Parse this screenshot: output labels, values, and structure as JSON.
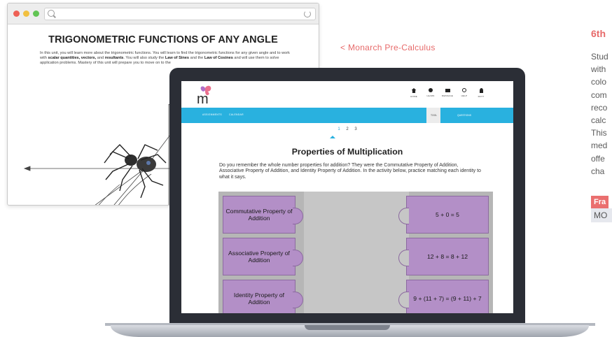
{
  "background_window": {
    "title": "TRIGONOMETRIC FUNCTIONS OF ANY ANGLE",
    "intro": {
      "p1": "In this unit, you will learn more about the trigonometric functions. You will learn to find the trigonometric functions for any given angle and to work with ",
      "b1": "scalar quantities, vectors,",
      "p2": " and ",
      "b2": "resultants",
      "p3": ". You will also study the ",
      "b3": "Law of Sines",
      "p4": " and the ",
      "b4": "Law of Cosines",
      "p5": " and will use them to solve application problems. Mastery of this unit will prepare you to move on to the"
    }
  },
  "back_link": "< Monarch Pre-Calculus",
  "right_column": {
    "heading": "6th",
    "lines": [
      "Stud",
      "with",
      "colo",
      "com",
      "reco",
      "calc",
      "This",
      "med",
      "offe",
      "cha"
    ],
    "badge": "Fra",
    "tag": "MO"
  },
  "app": {
    "nav": [
      {
        "label": "HOME",
        "icon": "home-icon"
      },
      {
        "label": "LEARN",
        "icon": "gear-icon"
      },
      {
        "label": "MESSAGE",
        "icon": "message-icon"
      },
      {
        "label": "HELP",
        "icon": "help-icon"
      },
      {
        "label": "MATT",
        "icon": "user-icon"
      }
    ],
    "bar": {
      "assignments": "ASSIGNMENTS",
      "calendar": "CALENDAR",
      "tab_active": "TOOL",
      "tab_other": "QUESTIONS"
    },
    "pager": [
      "1",
      "2",
      "3"
    ],
    "lesson": {
      "title": "Properties of Multiplication",
      "text": "Do you remember the whole number properties for addition? They were the Commutative Property of Addition, Associative Property of Addition, and Identity Property of Addition. In the activity below, practice matching each identity to what it says."
    },
    "pieces": [
      {
        "left": "Commutative Property of Addition",
        "right": "5 + 0 = 5"
      },
      {
        "left": "Associative Property of Addition",
        "right": "12 + 8 = 8 + 12"
      },
      {
        "left": "Identity Property of Addition",
        "right": "9 + (11 + 7) = (9 + 11) + 7"
      }
    ]
  }
}
